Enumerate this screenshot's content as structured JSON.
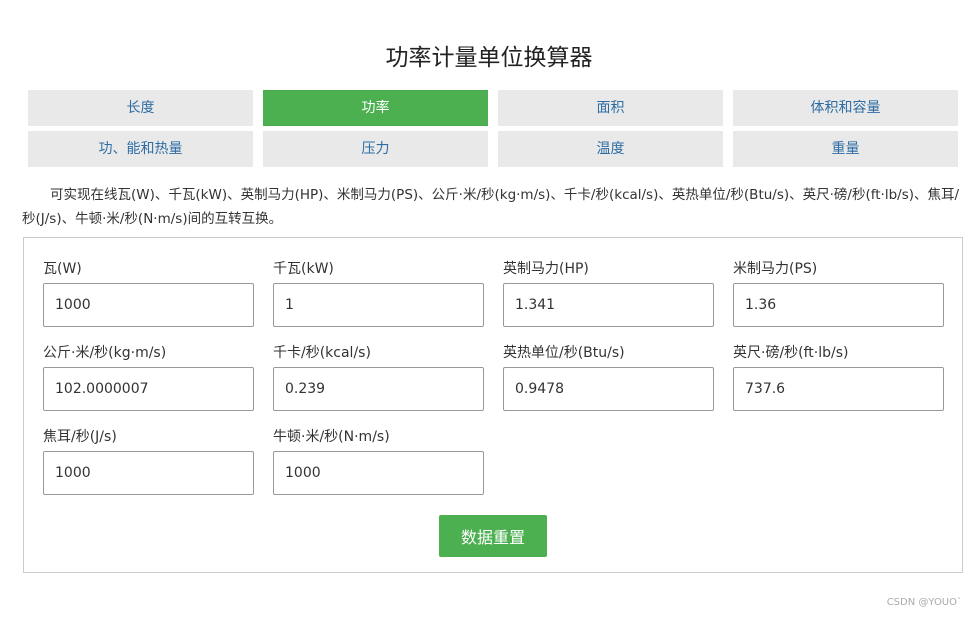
{
  "title": "功率计量单位换算器",
  "tabs": [
    {
      "label": "长度"
    },
    {
      "label": "功率"
    },
    {
      "label": "面积"
    },
    {
      "label": "体积和容量"
    },
    {
      "label": "功、能和热量"
    },
    {
      "label": "压力"
    },
    {
      "label": "温度"
    },
    {
      "label": "重量"
    }
  ],
  "active_tab": "功率",
  "description": "可实现在线瓦(W)、千瓦(kW)、英制马力(HP)、米制马力(PS)、公斤·米/秒(kg·m/s)、千卡/秒(kcal/s)、英热单位/秒(Btu/s)、英尺·磅/秒(ft·lb/s)、焦耳/秒(J/s)、牛顿·米/秒(N·m/s)间的互转互换。",
  "fields": [
    {
      "label": "瓦(W)",
      "value": "1000"
    },
    {
      "label": "千瓦(kW)",
      "value": "1"
    },
    {
      "label": "英制马力(HP)",
      "value": "1.341"
    },
    {
      "label": "米制马力(PS)",
      "value": "1.36"
    },
    {
      "label": "公斤·米/秒(kg·m/s)",
      "value": "102.0000007"
    },
    {
      "label": "千卡/秒(kcal/s)",
      "value": "0.239"
    },
    {
      "label": "英热单位/秒(Btu/s)",
      "value": "0.9478"
    },
    {
      "label": "英尺·磅/秒(ft·lb/s)",
      "value": "737.6"
    },
    {
      "label": "焦耳/秒(J/s)",
      "value": "1000"
    },
    {
      "label": "牛顿·米/秒(N·m/s)",
      "value": "1000"
    }
  ],
  "reset_label": "数据重置",
  "watermark": "CSDN @YOUO`",
  "colors": {
    "accent": "#4caf50",
    "tab_bg": "#e9e9e9",
    "tab_text": "#2e6da4"
  }
}
